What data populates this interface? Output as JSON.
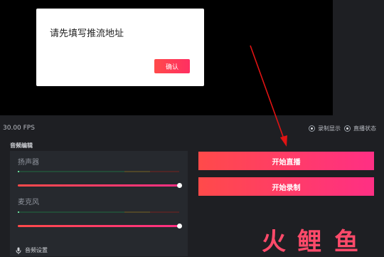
{
  "dialog": {
    "message": "请先填写推流地址",
    "confirm_label": "确认"
  },
  "status": {
    "fps": "30.00 FPS",
    "record_display_label": "录制显示",
    "live_status_label": "直播状态"
  },
  "audio": {
    "section_title": "音频编辑",
    "speaker_label": "扬声器",
    "mic_label": "麦克风",
    "settings_label": "音频设置"
  },
  "actions": {
    "start_live_label": "开始直播",
    "start_record_label": "开始录制"
  },
  "watermark": {
    "c1": "火",
    "c2": "鲤",
    "c3": "鱼"
  },
  "colors": {
    "accent": "#ff3f68",
    "arrow": "#e01313"
  }
}
